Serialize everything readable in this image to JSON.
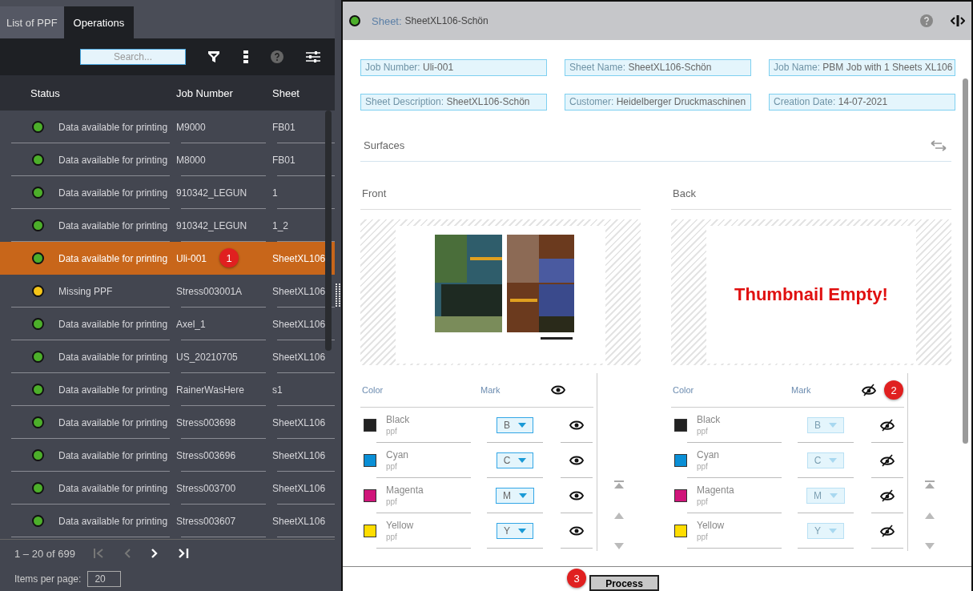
{
  "left_tabs": [
    {
      "label": "List of PPF",
      "selected": false
    },
    {
      "label": "Operations",
      "selected": true
    }
  ],
  "search": {
    "placeholder": "Search..."
  },
  "table": {
    "columns": [
      "Status",
      "Job Number",
      "Sheet"
    ],
    "rows": [
      {
        "status": "Data available for printing",
        "color": "#4caf2a",
        "job": "M9000",
        "sheet": "FB01",
        "selected": false
      },
      {
        "status": "Data available for printing",
        "color": "#4caf2a",
        "job": "M8000",
        "sheet": "FB01",
        "selected": false
      },
      {
        "status": "Data available for printing",
        "color": "#4caf2a",
        "job": "910342_LEGUN",
        "sheet": "1",
        "selected": false
      },
      {
        "status": "Data available for printing",
        "color": "#4caf2a",
        "job": "910342_LEGUN",
        "sheet": "1_2",
        "selected": false
      },
      {
        "status": "Data available for printing",
        "color": "#4caf2a",
        "job": "Uli-001",
        "sheet": "SheetXL106",
        "selected": true,
        "badge": "1"
      },
      {
        "status": "Missing PPF",
        "color": "#f5c518",
        "job": "Stress003001A",
        "sheet": "SheetXL106",
        "selected": false
      },
      {
        "status": "Data available for printing",
        "color": "#4caf2a",
        "job": "Axel_1",
        "sheet": "SheetXL106",
        "selected": false
      },
      {
        "status": "Data available for printing",
        "color": "#4caf2a",
        "job": "US_20210705",
        "sheet": "SheetXL106",
        "selected": false
      },
      {
        "status": "Data available for printing",
        "color": "#4caf2a",
        "job": "RainerWasHere",
        "sheet": "s1",
        "selected": false
      },
      {
        "status": "Data available for printing",
        "color": "#4caf2a",
        "job": "Stress003698",
        "sheet": "SheetXL106",
        "selected": false
      },
      {
        "status": "Data available for printing",
        "color": "#4caf2a",
        "job": "Stress003696",
        "sheet": "SheetXL106",
        "selected": false
      },
      {
        "status": "Data available for printing",
        "color": "#4caf2a",
        "job": "Stress003700",
        "sheet": "SheetXL106",
        "selected": false
      },
      {
        "status": "Data available for printing",
        "color": "#4caf2a",
        "job": "Stress003607",
        "sheet": "SheetXL106",
        "selected": false
      }
    ]
  },
  "pagination": {
    "range": "1 – 20 of 699"
  },
  "items_per_page": {
    "label": "Items per page:",
    "value": "20"
  },
  "sheet_header": {
    "label": "Sheet:",
    "value": "SheetXL106-Schön"
  },
  "fields": [
    {
      "label": "Job Number:",
      "value": "Uli-001"
    },
    {
      "label": "Sheet Name:",
      "value": "SheetXL106-Schön"
    },
    {
      "label": "Job Name:",
      "value": "PBM Job with 1 Sheets XL106"
    },
    {
      "label": "Sheet Description:",
      "value": "SheetXL106-Schön"
    },
    {
      "label": "Customer:",
      "value": "Heidelberger Druckmaschinen"
    },
    {
      "label": "Creation Date:",
      "value": "14-07-2021"
    }
  ],
  "surfaces": {
    "title": "Surfaces"
  },
  "sides": [
    {
      "title": "Front",
      "color_header": "Color",
      "mark_header": "Mark",
      "visible": true,
      "marks_disabled": false,
      "inks": [
        {
          "name": "Black",
          "source": "ppf",
          "color": "#222222",
          "mark": "B",
          "visible": true
        },
        {
          "name": "Cyan",
          "source": "ppf",
          "color": "#0a8fd6",
          "mark": "C",
          "visible": true
        },
        {
          "name": "Magenta",
          "source": "ppf",
          "color": "#d0157a",
          "mark": "M",
          "visible": true
        },
        {
          "name": "Yellow",
          "source": "ppf",
          "color": "#ffdd00",
          "mark": "Y",
          "visible": true
        }
      ]
    },
    {
      "title": "Back",
      "thumbnail": {
        "kind": "empty",
        "message": "Thumbnail Empty!"
      },
      "color_header": "Color",
      "mark_header": "Mark",
      "visible": false,
      "marks_disabled": true,
      "badge": "2",
      "inks": [
        {
          "name": "Black",
          "source": "ppf",
          "color": "#222222",
          "mark": "B",
          "visible": false
        },
        {
          "name": "Cyan",
          "source": "ppf",
          "color": "#0a8fd6",
          "mark": "C",
          "visible": false
        },
        {
          "name": "Magenta",
          "source": "ppf",
          "color": "#d0157a",
          "mark": "M",
          "visible": false
        },
        {
          "name": "Yellow",
          "source": "ppf",
          "color": "#ffdd00",
          "mark": "Y",
          "visible": false
        }
      ]
    }
  ],
  "process": {
    "label": "Process",
    "badge": "3"
  }
}
